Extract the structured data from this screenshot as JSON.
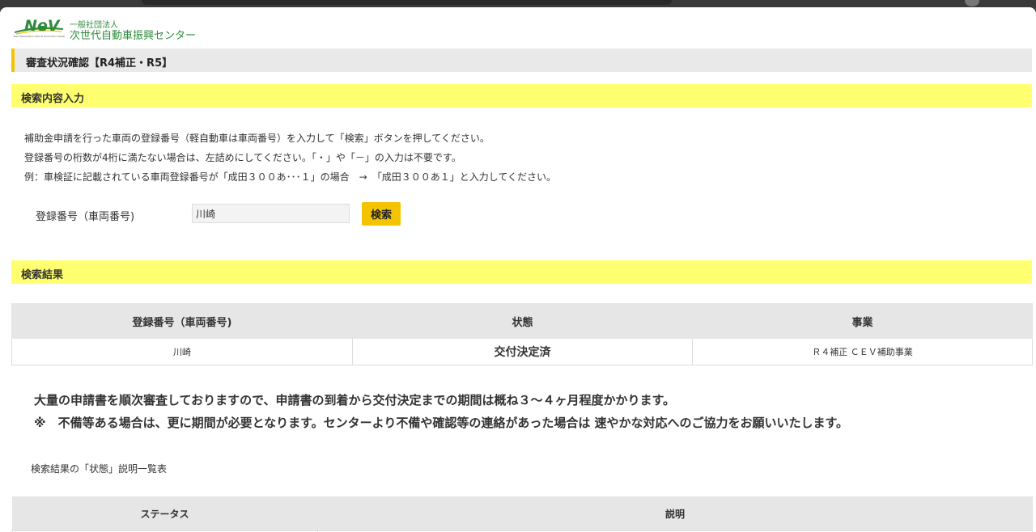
{
  "header": {
    "logo_text": "NeV",
    "logo_tagline": "Next Generation Vehicle Promotion Center",
    "org_type": "一般社団法人",
    "org_name": "次世代自動車振興センター"
  },
  "page_title": "審査状況確認【R4補正・R5】",
  "search_section": {
    "heading": "検索内容入力",
    "instructions": [
      "補助金申請を行った車両の登録番号（軽自動車は車両番号）を入力して「検索」ボタンを押してください。",
      "登録番号の桁数が4桁に満たない場合は、左詰めにしてください。「・」や「－」の入力は不要です。",
      "例：車検証に記載されている車両登録番号が「成田３００あ･･･１」の場合　→　「成田３００あ１」と入力してください。"
    ],
    "field_label": "登録番号（車両番号)",
    "field_value": "川崎",
    "search_button": "検索"
  },
  "results_section": {
    "heading": "検索結果",
    "columns": [
      "登録番号（車両番号)",
      "状態",
      "事業"
    ],
    "rows": [
      {
        "reg_no": "川崎",
        "status": "交付決定済",
        "program": "Ｒ４補正 ＣＥＶ補助事業"
      }
    ]
  },
  "notices": [
    "大量の申請書を順次審査しておりますので、申請書の到着から交付決定までの期間は概ね３～４ヶ月程度かかります。",
    "※　不備等ある場合は、更に期間が必要となります。センターより不備や確認等の連絡があった場合は 速やかな対応へのご協力をお願いいたします。"
  ],
  "status_legend": {
    "title": "検索結果の「状態」説明一覧表",
    "columns": [
      "ステータス",
      "説明"
    ]
  },
  "colors": {
    "accent_yellow": "#f5c400",
    "section_yellow": "#ffff70",
    "logo_green": "#2e8b3d"
  }
}
